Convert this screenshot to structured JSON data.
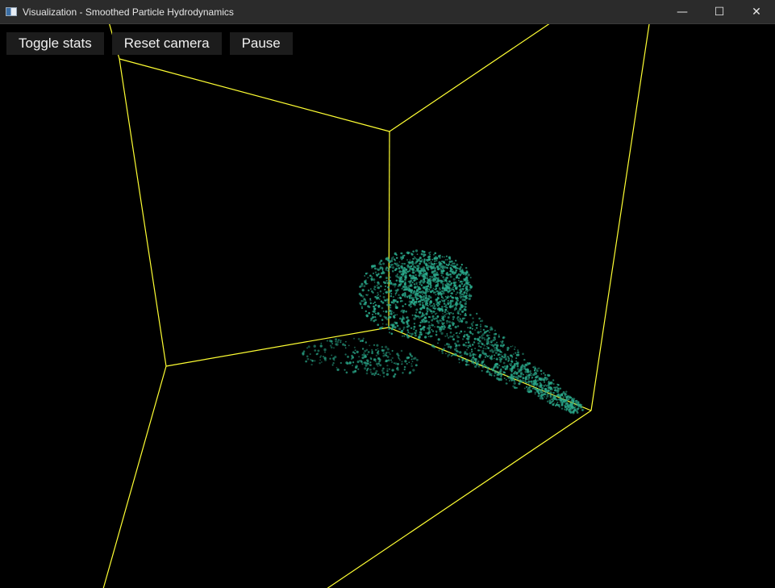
{
  "window": {
    "title": "Visualization - Smoothed Particle Hydrodynamics",
    "controls": {
      "minimize": "—",
      "maximize": "☐",
      "close": "✕"
    }
  },
  "toolbar": {
    "toggle_stats_label": "Toggle stats",
    "reset_camera_label": "Reset camera",
    "pause_label": "Pause"
  },
  "colors": {
    "background": "#000000",
    "box_edges": "#ffff33",
    "particles": "#2aa88a",
    "button_bg": "#1c1c1c"
  },
  "icons": [
    "app-window-icon",
    "minimize-icon",
    "maximize-icon",
    "close-icon"
  ]
}
